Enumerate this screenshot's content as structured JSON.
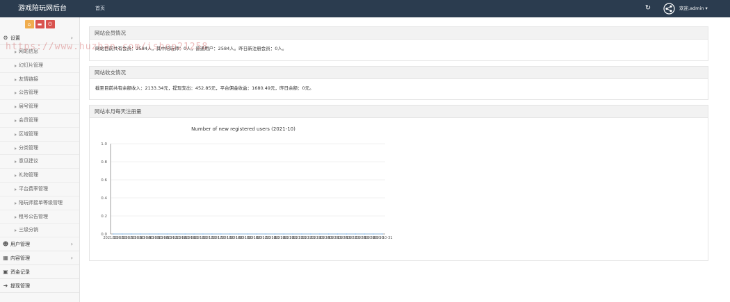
{
  "header": {
    "brand": "游戏陪玩网后台",
    "nav_home": "首页",
    "welcome": "欢迎,admin ▾",
    "refresh_glyph": "↻"
  },
  "sidebar": {
    "quick_buttons": [
      {
        "icon": "home-icon",
        "glyph": "⌂",
        "color": "#f0ad4e"
      },
      {
        "icon": "trash-icon",
        "glyph": "▬",
        "color": "#d9534f"
      },
      {
        "icon": "power-icon",
        "glyph": "⏻",
        "color": "#d9534f"
      }
    ],
    "groups": [
      {
        "label": "设置",
        "icon": "gears-icon",
        "glyph": "⚙",
        "expanded": true
      },
      {
        "label": "用户管理",
        "icon": "users-icon",
        "glyph": "☻"
      },
      {
        "label": "内容管理",
        "icon": "grid-icon",
        "glyph": "▦"
      },
      {
        "label": "资金记录",
        "icon": "money-icon",
        "glyph": "▣"
      },
      {
        "label": "提现管理",
        "icon": "sign-out-icon",
        "glyph": "➜"
      }
    ],
    "settings_items": [
      "网站信息",
      "幻灯片管理",
      "友情链接",
      "公告管理",
      "层号管理",
      "会员管理",
      "区域管理",
      "分类管理",
      "意见建议",
      "礼物管理",
      "平台费率管理",
      "陪玩师接单等级管理",
      "租号公告管理",
      "三级分销"
    ]
  },
  "panels": {
    "members_title": "网站会员情况",
    "members_text": "网站目前共有会员：2584人，其中陪玩师：0人，普通用户：2584人。昨日新注册会员：0人。",
    "finance_title": "网站收支情况",
    "finance_text": "截至目前共有余额收入：2133.34元，提现支出：452.85元，平台佣金收益：1680.49元，昨日余额：0元。",
    "chart_panel_title": "网站本月每天注册量"
  },
  "chart_data": {
    "type": "line",
    "title": "Number of new registered users (2021-10)",
    "x": [
      "2021-10-01",
      "2021-10-02",
      "2021-10-03",
      "2021-10-04",
      "2021-10-05",
      "2021-10-06",
      "2021-10-07",
      "2021-10-08",
      "2021-10-09",
      "2021-10-10",
      "2021-10-11",
      "2021-10-12",
      "2021-10-13",
      "2021-10-14",
      "2021-10-15",
      "2021-10-16",
      "2021-10-17",
      "2021-10-18",
      "2021-10-19",
      "2021-10-20",
      "2021-10-21",
      "2021-10-22",
      "2021-10-23",
      "2021-10-24",
      "2021-10-25",
      "2021-10-26",
      "2021-10-27",
      "2021-10-28",
      "2021-10-29",
      "2021-10-30",
      "2021-10-31"
    ],
    "y": [
      0,
      0,
      0,
      0,
      0,
      0,
      0,
      0,
      0,
      0,
      0,
      0,
      0,
      0,
      0,
      0,
      0,
      0,
      0,
      0,
      0,
      0,
      0,
      0,
      0,
      0,
      0,
      0,
      0,
      0,
      0
    ],
    "y_ticks": [
      "0.0",
      "0.2",
      "0.4",
      "0.6",
      "0.8",
      "1.0"
    ],
    "ylim": [
      0,
      1
    ],
    "grid": true
  },
  "watermark": "https://www.huzhan.com/ishop21258"
}
